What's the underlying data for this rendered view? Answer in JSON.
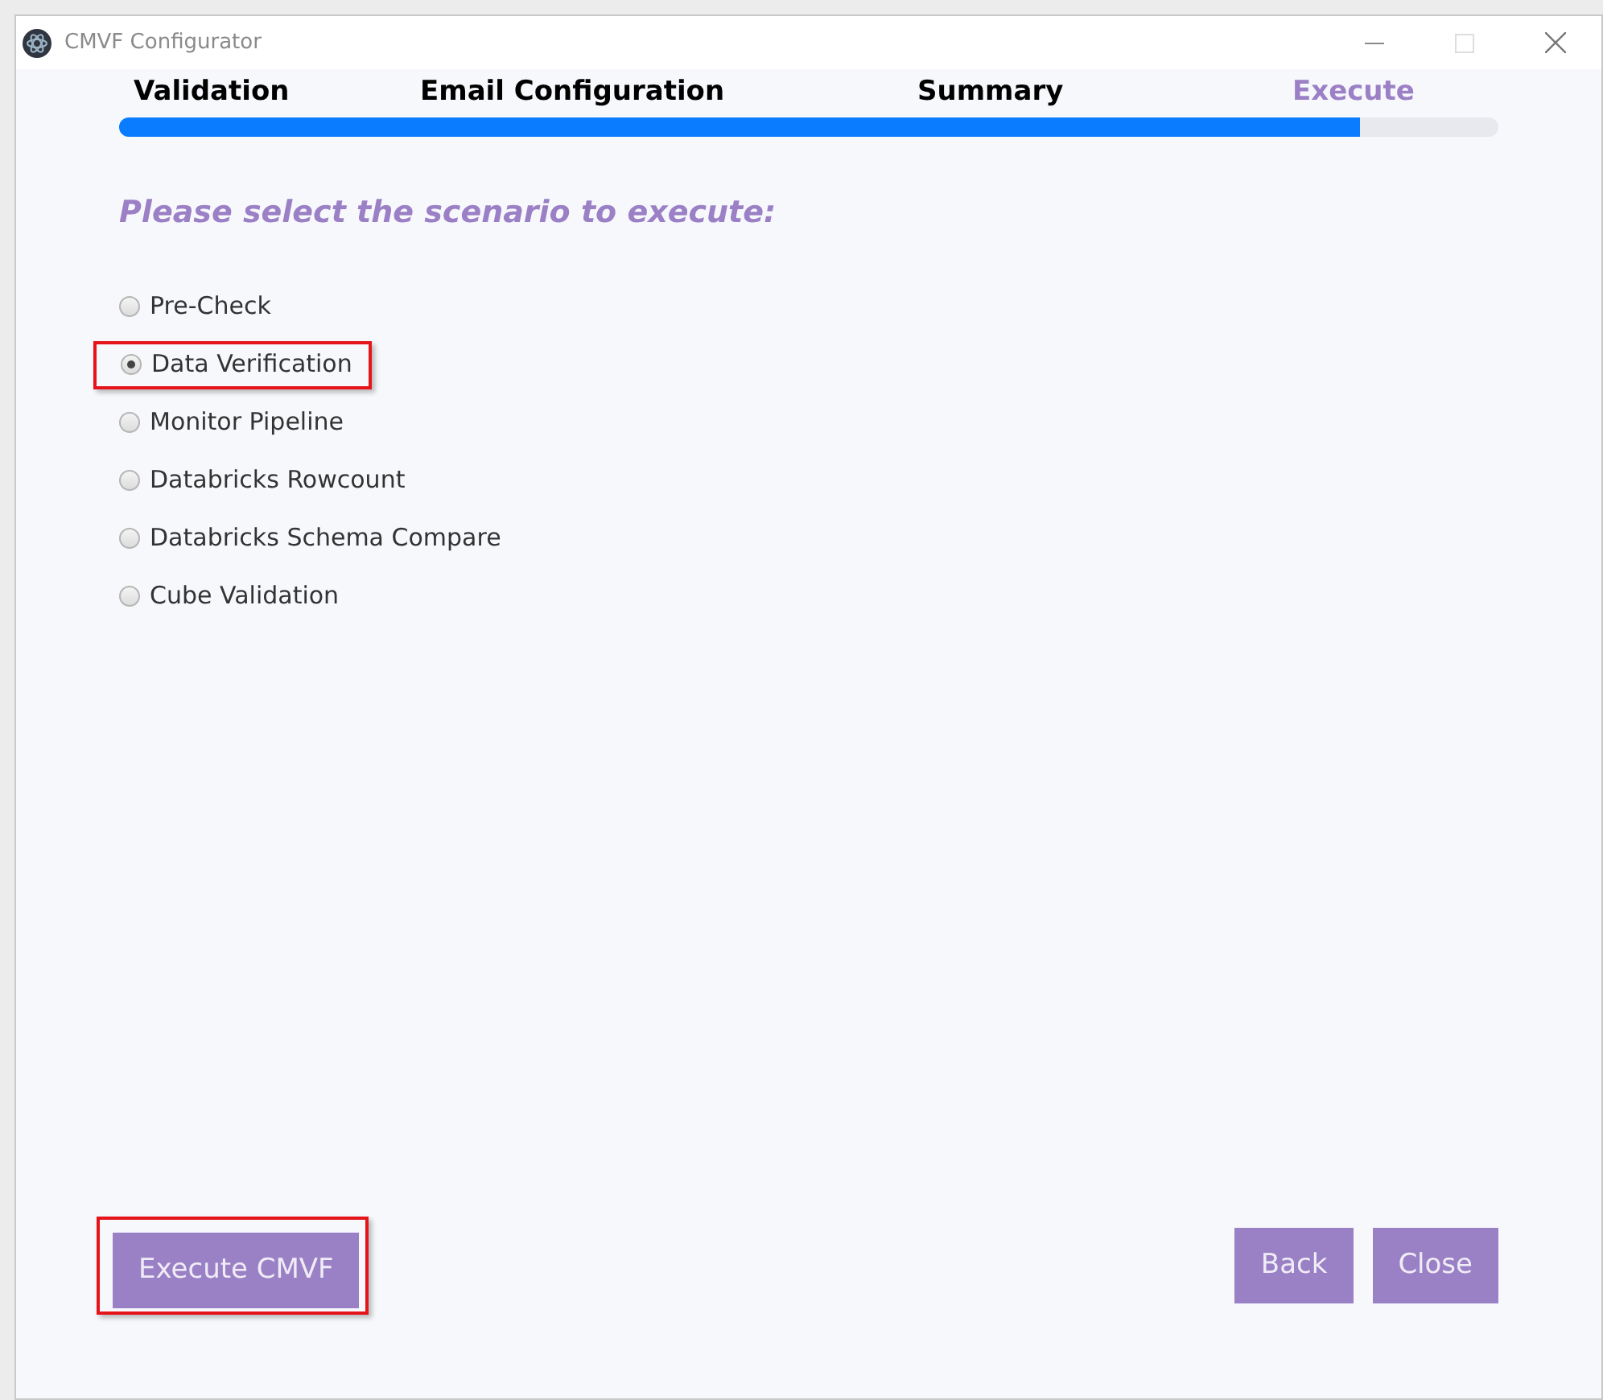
{
  "window": {
    "title": "CMVF Configurator"
  },
  "steps": [
    {
      "label": "Validation",
      "selected": false
    },
    {
      "label": "Email Configuration",
      "selected": false
    },
    {
      "label": "Summary",
      "selected": false
    },
    {
      "label": "Execute",
      "selected": true
    }
  ],
  "progress": {
    "level": 0.9
  },
  "prompt": "Please select the scenario to execute:",
  "scenarios": [
    {
      "label": "Pre-Check",
      "selected": false,
      "highlighted": false
    },
    {
      "label": "Data Verification",
      "selected": true,
      "highlighted": true
    },
    {
      "label": "Monitor Pipeline",
      "selected": false,
      "highlighted": false
    },
    {
      "label": "Databricks Rowcount",
      "selected": false,
      "highlighted": false
    },
    {
      "label": "Databricks Schema Compare",
      "selected": false,
      "highlighted": false
    },
    {
      "label": "Cube Validation",
      "selected": false,
      "highlighted": false
    }
  ],
  "buttons": [
    {
      "label": "Execute CMVF",
      "highlighted": true
    },
    {
      "label": "Back",
      "highlighted": false
    },
    {
      "label": "Close",
      "highlighted": false
    }
  ]
}
